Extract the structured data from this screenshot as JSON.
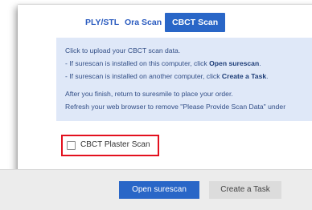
{
  "tabs": [
    {
      "label": "PLY/STL",
      "active": false
    },
    {
      "label": "Ora Scan",
      "active": false
    },
    {
      "label": "CBCT Scan",
      "active": true
    }
  ],
  "info": {
    "line1": "Click to upload your CBCT scan data.",
    "line2_prefix": "- If surescan is installed on this computer, click ",
    "line2_bold": "Open surescan",
    "line2_suffix": ".",
    "line3_prefix": "- If surescan is installed on another computer, click ",
    "line3_bold": "Create a Task",
    "line3_suffix": ".",
    "line4": "After you finish, return to suresmile to place your order.",
    "line5": "Refresh your web browser to remove \"Please Provide Scan Data\" under"
  },
  "plaster": {
    "label": "CBCT Plaster Scan",
    "checked": false
  },
  "buttons": {
    "open_label": "Open surescan",
    "task_label": "Create a Task"
  },
  "colors": {
    "accent": "#2966c7",
    "info_bg": "#dfe8f8",
    "highlight": "#e3101e"
  }
}
